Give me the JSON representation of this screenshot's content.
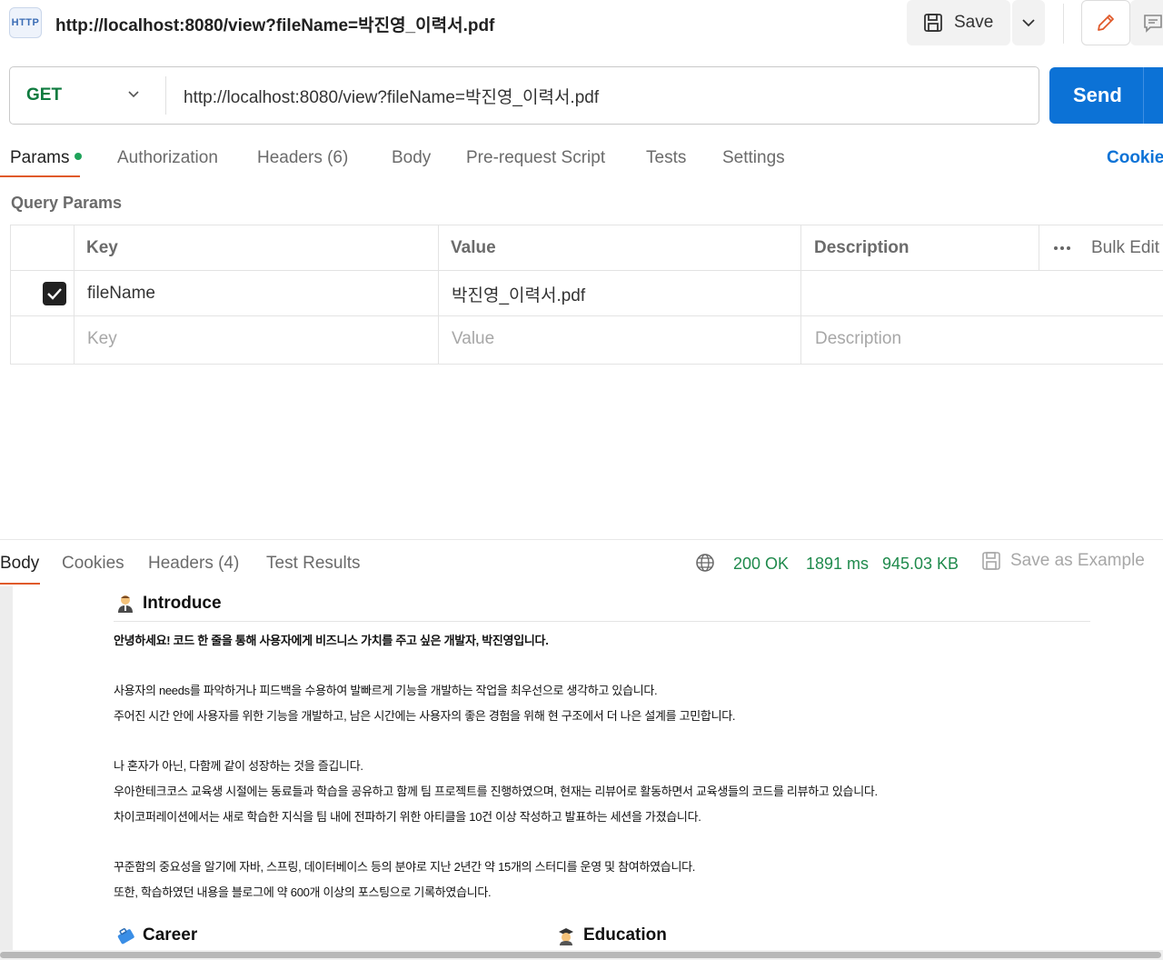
{
  "header": {
    "http_icon_label": "HTTP",
    "title": "http://localhost:8080/view?fileName=박진영_이력서.pdf",
    "save_label": "Save"
  },
  "request": {
    "method": "GET",
    "url": "http://localhost:8080/view?fileName=박진영_이력서.pdf",
    "send_label": "Send"
  },
  "request_tabs": [
    "Params",
    "Authorization",
    "Headers (6)",
    "Body",
    "Pre-request Script",
    "Tests",
    "Settings"
  ],
  "cookies_label": "Cookie",
  "params": {
    "section_title": "Query Params",
    "headers": {
      "key": "Key",
      "value": "Value",
      "description": "Description",
      "bulk_edit": "Bulk Edit"
    },
    "rows": [
      {
        "key": "fileName",
        "value": "박진영_이력서.pdf",
        "description": "",
        "checked": true
      }
    ],
    "placeholder": {
      "key": "Key",
      "value": "Value",
      "description": "Description"
    }
  },
  "response": {
    "tabs": [
      "Body",
      "Cookies",
      "Headers (4)",
      "Test Results"
    ],
    "status": "200 OK",
    "time": "1891 ms",
    "size": "945.03 KB",
    "save_example_label": "Save as Example"
  },
  "preview": {
    "introduce_heading": "Introduce",
    "lines": [
      "안녕하세요! 코드 한 줄을 통해 사용자에게 비즈니스 가치를 주고 싶은 개발자, 박진영입니다.",
      "사용자의 needs를 파악하거나 피드백을 수용하여 발빠르게 기능을 개발하는 작업을 최우선으로 생각하고 있습니다.",
      "주어진 시간 안에 사용자를 위한 기능을 개발하고, 남은 시간에는 사용자의 좋은 경험을 위해 현 구조에서 더 나은 설계를 고민합니다.",
      "나 혼자가 아닌, 다함께 같이 성장하는 것을 즐깁니다.",
      "우아한테크코스 교육생 시절에는 동료들과 학습을 공유하고 함께 팀 프로젝트를 진행하였으며, 현재는 리뷰어로 활동하면서 교육생들의 코드를 리뷰하고 있습니다.",
      "차이코퍼레이션에서는 새로 학습한 지식을 팀 내에 전파하기 위한 아티클을 10건 이상 작성하고 발표하는 세션을 가졌습니다.",
      "꾸준함의 중요성을 알기에 자바, 스프링, 데이터베이스 등의 분야로 지난 2년간 약 15개의 스터디를 운영 및 참여하였습니다.",
      "또한, 학습하였던 내용을 블로그에 약 600개 이상의 포스팅으로 기록하였습니다."
    ],
    "career_heading": "Career",
    "education_heading": "Education"
  }
}
